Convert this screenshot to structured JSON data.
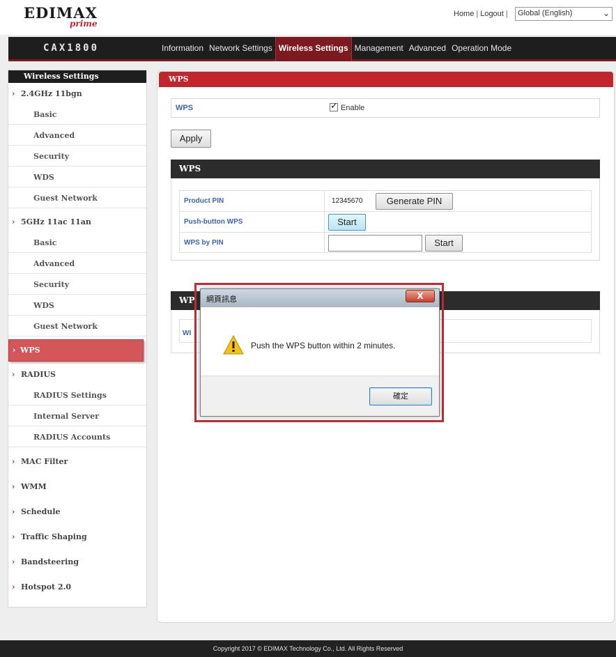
{
  "header": {
    "logo_text": "EDIMAX",
    "logo_sub": "prime",
    "links": {
      "home": "Home",
      "logout": "Logout"
    },
    "separator": "|",
    "language": "Global (English)"
  },
  "navbar": {
    "model": "CAX1800",
    "tabs": [
      "Information",
      "Network Settings",
      "Wireless Settings",
      "Management",
      "Advanced",
      "Operation Mode"
    ],
    "active_tab": "Wireless Settings"
  },
  "sidebar": {
    "title": "Wireless Settings",
    "items": [
      {
        "label": "2.4GHz 11bgn",
        "type": "section"
      },
      {
        "label": "Basic",
        "type": "sub"
      },
      {
        "label": "Advanced",
        "type": "sub"
      },
      {
        "label": "Security",
        "type": "sub"
      },
      {
        "label": "WDS",
        "type": "sub"
      },
      {
        "label": "Guest Network",
        "type": "sub"
      },
      {
        "label": "5GHz 11ac 11an",
        "type": "section"
      },
      {
        "label": "Basic",
        "type": "sub"
      },
      {
        "label": "Advanced",
        "type": "sub"
      },
      {
        "label": "Security",
        "type": "sub"
      },
      {
        "label": "WDS",
        "type": "sub"
      },
      {
        "label": "Guest Network",
        "type": "sub"
      },
      {
        "label": "WPS",
        "type": "active"
      },
      {
        "label": "RADIUS",
        "type": "section"
      },
      {
        "label": "RADIUS Settings",
        "type": "sub"
      },
      {
        "label": "Internal Server",
        "type": "sub"
      },
      {
        "label": "RADIUS Accounts",
        "type": "sub"
      },
      {
        "label": "MAC Filter",
        "type": "section"
      },
      {
        "label": "WMM",
        "type": "section"
      },
      {
        "label": "Schedule",
        "type": "section"
      },
      {
        "label": "Traffic Shaping",
        "type": "section"
      },
      {
        "label": "Bandsteering",
        "type": "section"
      },
      {
        "label": "Hotspot 2.0",
        "type": "section"
      }
    ]
  },
  "main": {
    "panel_title": "WPS",
    "wps_row": {
      "label": "WPS",
      "checkbox_label": "Enable",
      "checked": true
    },
    "apply_label": "Apply",
    "section1_title": "WPS",
    "product_pin": {
      "label": "Product PIN",
      "value": "12345670",
      "button": "Generate PIN"
    },
    "push_button": {
      "label": "Push-button WPS",
      "button": "Start"
    },
    "wps_by_pin": {
      "label": "WPS by PIN",
      "value": "",
      "button": "Start"
    },
    "section2_title_partial": "WP",
    "status_label_partial": "WI"
  },
  "dialog": {
    "title": "網頁訊息",
    "close": "X",
    "message": "Push the WPS button within 2 minutes.",
    "ok_label": "確定"
  },
  "footer": {
    "copyright": "Copyright 2017 © EDIMAX Technology Co., Ltd. All Rights Reserved"
  },
  "colors": {
    "accent_red": "#c0262c",
    "nav_bg": "#1e1e1e",
    "label_blue": "#3a64b0",
    "active_sidebar": "#d45658"
  }
}
